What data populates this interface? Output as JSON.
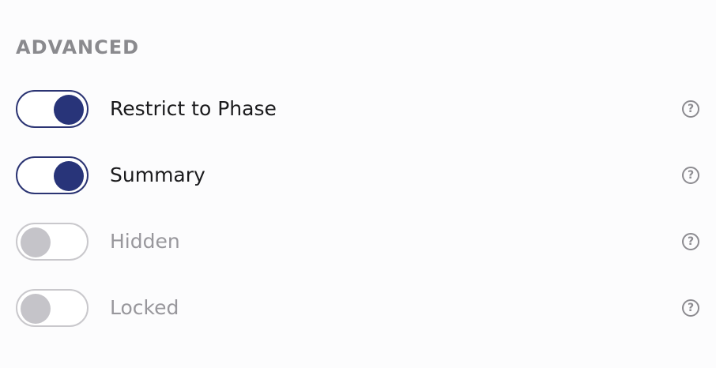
{
  "section": {
    "title": "ADVANCED"
  },
  "options": [
    {
      "label": "Restrict to Phase",
      "enabled": true,
      "help_icon": "question-mark-circle-icon"
    },
    {
      "label": "Summary",
      "enabled": true,
      "help_icon": "question-mark-circle-icon"
    },
    {
      "label": "Hidden",
      "enabled": false,
      "help_icon": "question-mark-circle-icon"
    },
    {
      "label": "Locked",
      "enabled": false,
      "help_icon": "question-mark-circle-icon"
    }
  ],
  "help_glyph": "?",
  "colors": {
    "toggle_on": "#283479",
    "toggle_off": "#c5c4c9",
    "section_title": "#8a8a8e"
  }
}
